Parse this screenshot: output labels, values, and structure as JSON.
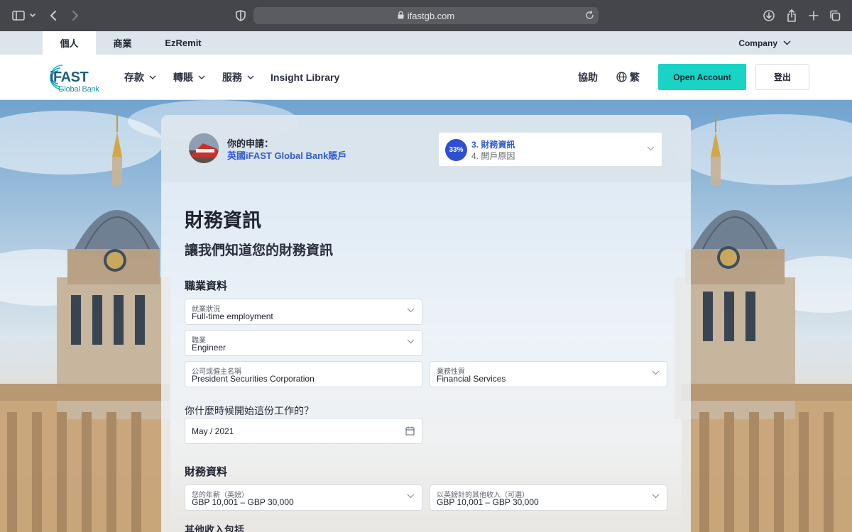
{
  "browser": {
    "url": "ifastgb.com"
  },
  "segments": {
    "tabs": [
      "個人",
      "商業",
      "EzRemit"
    ],
    "active_index": 0,
    "company_label": "Company"
  },
  "nav": {
    "logo_word": "iFAST",
    "logo_sub": "Global Bank",
    "menu": [
      "存款",
      "轉賬",
      "服務",
      "Insight Library"
    ],
    "help": "協助",
    "language": "繁",
    "open_account": "Open Account",
    "logout": "登出"
  },
  "application": {
    "label": "你的申請：",
    "name": "英國iFAST Global Bank賬戶",
    "progress_percent": "33%",
    "current_step": "3. 財務資訊",
    "next_step": "4. 開戶原因"
  },
  "form": {
    "title": "財務資訊",
    "subtitle": "讓我們知道您的財務資訊",
    "employment_section": "職業資料",
    "employment_status": {
      "label": "就業狀況",
      "value": "Full-time employment"
    },
    "occupation": {
      "label": "職業",
      "value": "Engineer"
    },
    "employer": {
      "label": "公司或僱主名稱",
      "value": "President Securities Corporation"
    },
    "industry": {
      "label": "業務性質",
      "value": "Financial Services"
    },
    "start_question": "你什麼時候開始這份工作的？",
    "start_date": "May / 2021",
    "financial_section": "財務資料",
    "annual_income": {
      "label": "您的年薪（英鎊）",
      "value": "GBP 10,001 – GBP 30,000"
    },
    "other_income": {
      "label": "以英鎊計的其他收入（可選）",
      "value": "GBP 10,001 – GBP 30,000"
    },
    "other_income_includes": "其他收入包括"
  },
  "colors": {
    "accent_teal": "#19d3c5",
    "link_blue": "#2f5bd6",
    "progress_blue": "#2f4fd1"
  }
}
